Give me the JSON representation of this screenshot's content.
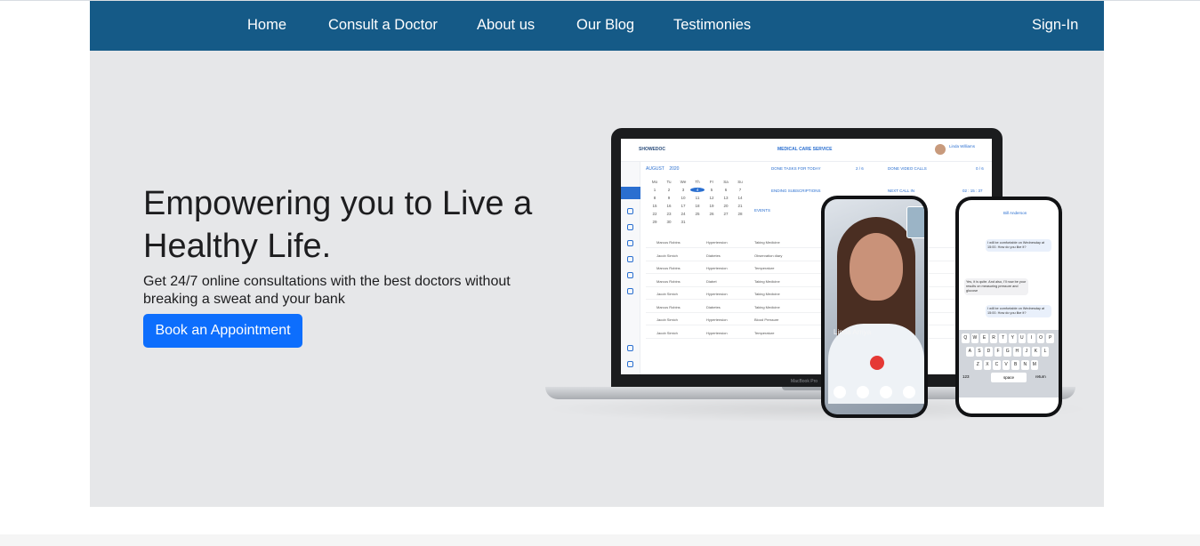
{
  "nav": {
    "home": "Home",
    "consult": "Consult a Doctor",
    "about": "About us",
    "blog": "Our Blog",
    "testimonies": "Testimonies",
    "signin": "Sign-In"
  },
  "hero": {
    "title": "Empowering you to Live a Healthy Life.",
    "subtitle": "Get 24/7 online consultations with the best doctors without breaking a sweat and your bank",
    "cta": "Book an Appointment"
  },
  "illustration": {
    "laptop_label": "MacBook Pro",
    "app_logo": "SHOWEDOC",
    "app_title": "MEDICAL CARE SERVICE",
    "app_user": "Linda Williams",
    "calendar_month": "AUGUST",
    "calendar_year": "2020",
    "weekdays": [
      "Mo",
      "Tu",
      "We",
      "Th",
      "Fr",
      "Sa",
      "Su"
    ],
    "days": [
      "1",
      "2",
      "3",
      "4",
      "5",
      "6",
      "7",
      "8",
      "9",
      "10",
      "11",
      "12",
      "13",
      "14",
      "15",
      "16",
      "17",
      "18",
      "19",
      "20",
      "21",
      "22",
      "23",
      "24",
      "25",
      "26",
      "27",
      "28",
      "29",
      "30",
      "31"
    ],
    "stat_tasks": "DONE TASKS FOR TODAY",
    "stat_tasks_value": "2 / 6",
    "stat_calls": "DONE VIDEO CALLS",
    "stat_calls_value": "0 / 6",
    "stat_subs": "ENDING SUBSCRIPTIONS",
    "stat_next": "NEXT CALL IN",
    "stat_next_value": "02 : 15 : 37",
    "events_label": "EVENTS",
    "rows": [
      {
        "name": "Marcus Robins",
        "condition": "Hypertension",
        "task": "Taking Medicine"
      },
      {
        "name": "Jacob Simich",
        "condition": "Diabetes",
        "task": "Observation diary"
      },
      {
        "name": "Marcus Robins",
        "condition": "Hypertension",
        "task": "Temperature"
      },
      {
        "name": "Marcus Robins",
        "condition": "Diabet",
        "task": "Taking Medicine"
      },
      {
        "name": "Jacob Simich",
        "condition": "Hypertension",
        "task": "Taking Medicine"
      },
      {
        "name": "Marcus Robins",
        "condition": "Diabetes",
        "task": "Taking Medicine"
      },
      {
        "name": "Jacob Simich",
        "condition": "Hypertension",
        "task": "Blood Pressure"
      },
      {
        "name": "Jacob Simich",
        "condition": "Hypertension",
        "task": "Temperature"
      }
    ],
    "doctor_name": "Linda Arriya",
    "chat_name": "Bill Anderson",
    "chat_msg_1": "I will be comfortable on Wednesday at 15:00. How do you like it?",
    "chat_msg_2": "Yes, it is quite. And also, I'll now be your results on measuring pressure and glucose",
    "chat_msg_3": "I will be comfortable on Wednesday at 15:00. How do you like it?",
    "keys_row1": [
      "Q",
      "W",
      "E",
      "R",
      "T",
      "Y",
      "U",
      "I",
      "O",
      "P"
    ],
    "keys_row2": [
      "A",
      "S",
      "D",
      "F",
      "G",
      "H",
      "J",
      "K",
      "L"
    ],
    "keys_row3": [
      "Z",
      "X",
      "C",
      "V",
      "B",
      "N",
      "M"
    ],
    "key_space": "space",
    "key_return": "return",
    "key_123": "123"
  }
}
